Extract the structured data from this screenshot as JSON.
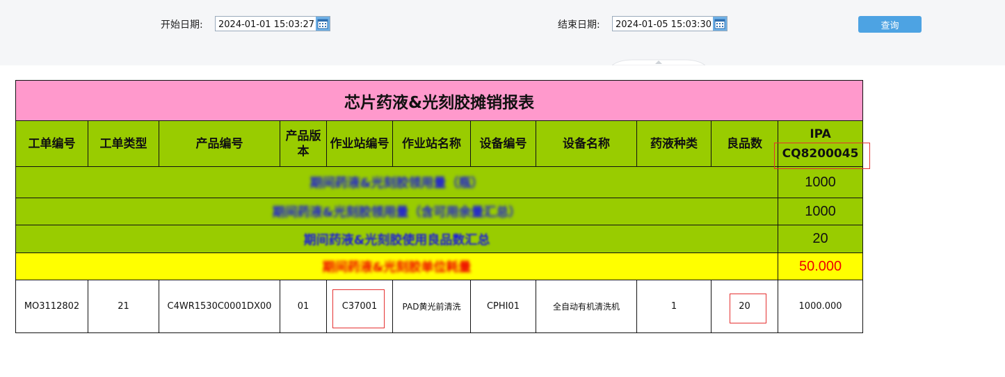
{
  "filters": {
    "start_label": "开始日期:",
    "start_value": "2024-01-01 15:03:27",
    "end_label": "结束日期:",
    "end_value": "2024-01-05 15:03:30",
    "query_button": "查询",
    "calendar_icon": "calendar-icon"
  },
  "report": {
    "title": "芯片药液&光刻胶摊销报表",
    "headers": [
      "工单编号",
      "工单类型",
      "产品编号",
      "产品版本",
      "作业站编号",
      "作业站名称",
      "设备编号",
      "设备名称",
      "药液种类",
      "良品数"
    ],
    "chem_header_name": "IPA",
    "chem_header_code": "CQ8200045",
    "summary_rows": [
      {
        "label": "期间药液&光刻胶领用量（瓶）",
        "value": "1000"
      },
      {
        "label": "期间药液&光刻胶领用量（含可用余量汇总）",
        "value": "1000"
      },
      {
        "label": "期间药液&光刻胶使用良品数汇总",
        "value": "20"
      }
    ],
    "average_row": {
      "label": "期间药液&光刻胶单位耗量",
      "value": "50.000"
    },
    "data_rows": [
      {
        "work_order": "MO3112802",
        "order_type": "21",
        "product_code": "C4WR1530C0001DX00",
        "product_version": "01",
        "station_code": "C37001",
        "station_name": "PAD黄光前清洗",
        "equipment_code": "CPHI01",
        "equipment_name": "全自动有机清洗机",
        "chem_type": "1",
        "good_qty": "20",
        "chem_amount": "1000.000"
      }
    ]
  },
  "colors": {
    "title_bg": "#ff99cc",
    "header_bg": "#99cc00",
    "average_bg": "#ffff00",
    "summary_label": "#1a1adb",
    "average_text": "#e00000",
    "highlight_box": "#e53030",
    "query_button": "#4da3e3"
  }
}
